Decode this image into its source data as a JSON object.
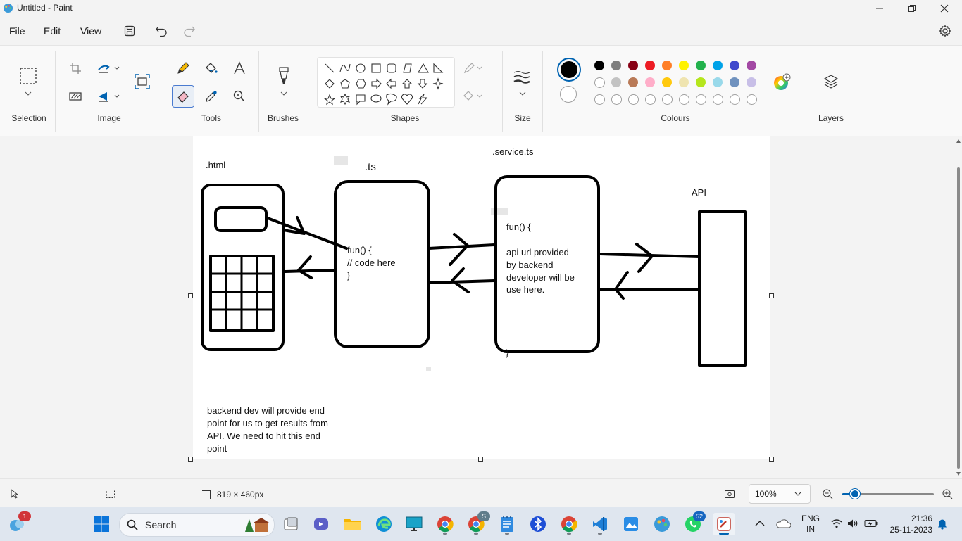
{
  "window": {
    "title": "Untitled - Paint"
  },
  "menu": {
    "file": "File",
    "edit": "Edit",
    "view": "View"
  },
  "ribbon": {
    "groups": {
      "selection": "Selection",
      "image": "Image",
      "tools": "Tools",
      "brushes": "Brushes",
      "shapes": "Shapes",
      "size": "Size",
      "colours": "Colours",
      "layers": "Layers"
    },
    "palette_row1": [
      "#000000",
      "#7f7f7f",
      "#880015",
      "#ed1c24",
      "#ff7f27",
      "#fff200",
      "#22b14c",
      "#00a2e8",
      "#3f48cc",
      "#a349a4"
    ],
    "palette_row2": [
      "#ffffff",
      "#c3c3c3",
      "#b97a57",
      "#ffaec9",
      "#ffc90e",
      "#efe4b0",
      "#b5e61d",
      "#99d9ea",
      "#7092be",
      "#c8bfe7"
    ],
    "primary_color": "#000000",
    "secondary_color": "#ffffff"
  },
  "canvas": {
    "labels": {
      "html": ".html",
      "ts": ".ts",
      "service": ".service.ts",
      "api": "API"
    },
    "ts_code": [
      "fun() {",
      "// code here",
      "}"
    ],
    "service_code": [
      "fun() {",
      "",
      "api url provided",
      "by backend",
      "developer will be",
      "use here."
    ],
    "service_brace": "}",
    "note": [
      "backend dev will provide end",
      "point for us to get results from",
      "API. We need to hit this end",
      "point"
    ]
  },
  "status": {
    "canvas_size": "819 × 460px",
    "zoom": "100%",
    "zoom_fraction": 0.14
  },
  "taskbar": {
    "search_placeholder": "Search",
    "start_badge": "1",
    "whatsapp_badge": "52",
    "chrome_profile_badge": "S",
    "lang_top": "ENG",
    "lang_bottom": "IN",
    "time": "21:36",
    "date": "25-11-2023"
  }
}
